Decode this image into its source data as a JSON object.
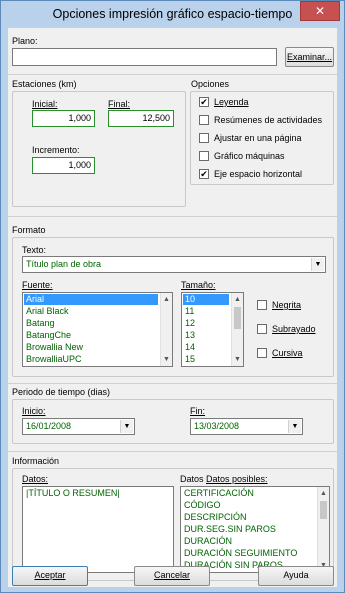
{
  "window": {
    "title": "Opciones impresión gráfico espacio-tiempo",
    "close_glyph": "✕"
  },
  "plano": {
    "label": "Plano:",
    "value": "",
    "browse_label": "Examinar..."
  },
  "estaciones": {
    "title": "Estaciones (km)",
    "inicial_label": "Inicial:",
    "inicial_value": "1,000",
    "final_label": "Final:",
    "final_value": "12,500",
    "incremento_label": "Incremento:",
    "incremento_value": "1,000"
  },
  "opciones": {
    "title": "Opciones",
    "items": [
      {
        "label": "Leyenda",
        "checked": true
      },
      {
        "label": "Resúmenes de actividades",
        "checked": false
      },
      {
        "label": "Ajustar en una página",
        "checked": false
      },
      {
        "label": "Gráfico máquinas",
        "checked": false
      },
      {
        "label": "Eje espacio horizontal",
        "checked": true
      }
    ]
  },
  "formato": {
    "title": "Formato",
    "texto_label": "Texto:",
    "texto_value": "Título plan de obra",
    "fuente_label": "Fuente:",
    "fuentes": [
      "Arial",
      "Arial Black",
      "Batang",
      "BatangChe",
      "Browallia New",
      "BrowalliaUPC"
    ],
    "fuente_selected": "Arial",
    "tamano_label": "Tamaño:",
    "tamanos": [
      "10",
      "11",
      "12",
      "13",
      "14",
      "15"
    ],
    "tamano_selected": "10",
    "negrita_label": "Negrita",
    "subrayado_label": "Subrayado",
    "cursiva_label": "Cursiva"
  },
  "periodo": {
    "title": "Periodo de tiempo (dias)",
    "inicio_label": "Inicio:",
    "inicio_value": "16/01/2008",
    "fin_label": "Fin:",
    "fin_value": "13/03/2008"
  },
  "informacion": {
    "title": "Información",
    "datos_label": "Datos:",
    "datos": [
      "|TÍTULO O RESUMEN|"
    ],
    "posibles_label": "Datos posibles:",
    "posibles": [
      "CERTIFICACIÓN",
      "CÓDIGO",
      "DESCRIPCIÓN",
      "DUR.SEG.SIN PAROS",
      "DURACIÓN",
      "DURACIÓN SEGUIMIENTO",
      "DURACIÓN SIN PAROS"
    ]
  },
  "buttons": {
    "accept": "Aceptar",
    "cancel": "Cancelar",
    "help": "Ayuda"
  },
  "icons": {
    "check": "✔",
    "arrow_down": "▼",
    "arrow_up": "▲"
  }
}
